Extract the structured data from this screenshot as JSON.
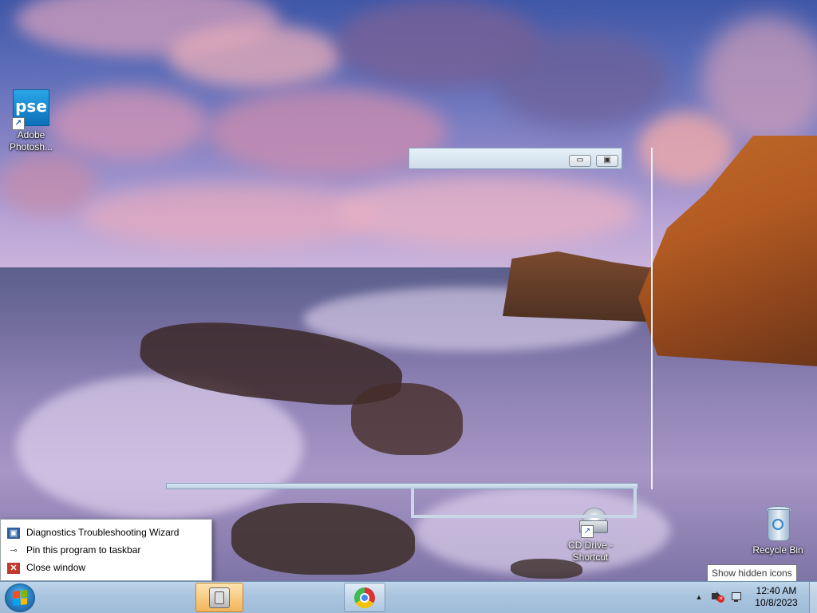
{
  "desktop": {
    "icons": [
      {
        "label": "Adobe Photosh...",
        "icon": "photoshop-elements-icon",
        "tile_text": "pse"
      },
      {
        "label": "CD Drive - Shortcut",
        "icon": "cd-drive-icon"
      },
      {
        "label": "Recycle Bin",
        "icon": "recycle-bin-icon"
      }
    ]
  },
  "window_outline": {
    "minimize_glyph": "▭",
    "maximize_glyph": "▣"
  },
  "jump_list": {
    "items": [
      {
        "label": "Diagnostics Troubleshooting Wizard",
        "icon": "diagnostics-icon"
      },
      {
        "label": "Pin this program to taskbar",
        "icon": "pin-icon"
      },
      {
        "label": "Close window",
        "icon": "close-icon"
      }
    ]
  },
  "tooltip": {
    "text": "Show hidden icons"
  },
  "taskbar": {
    "start": {
      "icon": "windows-start-orb"
    },
    "buttons": [
      {
        "app": "diagnostics",
        "icon": "diagnostics-wizard-icon",
        "active": true
      },
      {
        "app": "chrome",
        "icon": "chrome-icon",
        "active": false
      }
    ],
    "tray": {
      "show_hidden_glyph": "▲",
      "time": "12:40 AM",
      "date": "10/8/2023"
    }
  },
  "colors": {
    "taskbar": "#a9c4de",
    "active_button": "#f2b45a",
    "jumplist_bg": "#ffffff"
  }
}
